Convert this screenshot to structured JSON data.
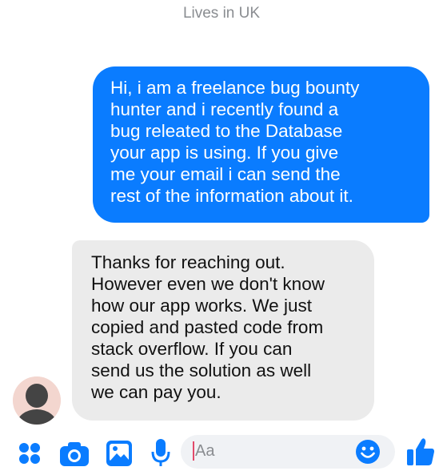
{
  "header": {
    "subtitle": "Lives in UK"
  },
  "messages": [
    {
      "direction": "outgoing",
      "text": "Hi, i am a freelance bug bounty\nhunter and i recently found a\nbug releated to the Database\nyour app is using. If you give\nme your email i can send the\nrest of the information about it."
    },
    {
      "direction": "incoming",
      "text": "Thanks for reaching out.\nHowever even we don't know\nhow our app works. We just\ncopied and pasted code from\nstack overflow. If you can\nsend us the solution as well\nwe can pay you."
    }
  ],
  "composer": {
    "placeholder": "Aa",
    "icons": [
      "apps-icon",
      "camera-icon",
      "image-icon",
      "microphone-icon",
      "emoji-icon",
      "thumbs-up-icon"
    ]
  },
  "colors": {
    "accent": "#0a7cff",
    "incoming_bubble": "#ebebeb",
    "subtitle": "#8a8d91"
  }
}
